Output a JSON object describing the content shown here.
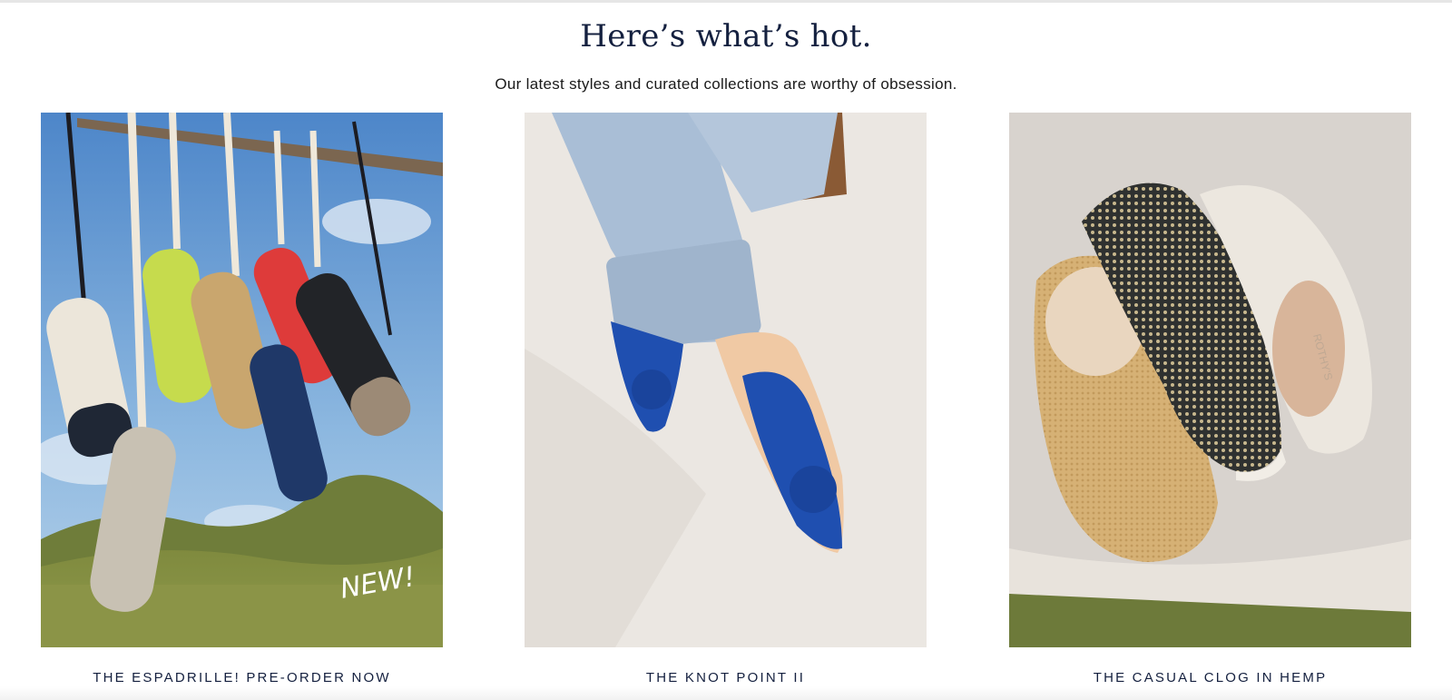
{
  "section": {
    "title": "Here’s what’s hot.",
    "subtitle": "Our latest styles and curated collections are worthy of obsession."
  },
  "cards": [
    {
      "link_label": "THE ESPADRILLE! PRE-ORDER NOW",
      "image": "espadrilles-hanging-image",
      "badge": "NEW!"
    },
    {
      "link_label": "THE KNOT POINT II",
      "image": "blue-knot-flats-image"
    },
    {
      "link_label": "THE CASUAL CLOG IN HEMP",
      "image": "hemp-clogs-image",
      "shoe_imprint": "ROTHY'S"
    }
  ]
}
